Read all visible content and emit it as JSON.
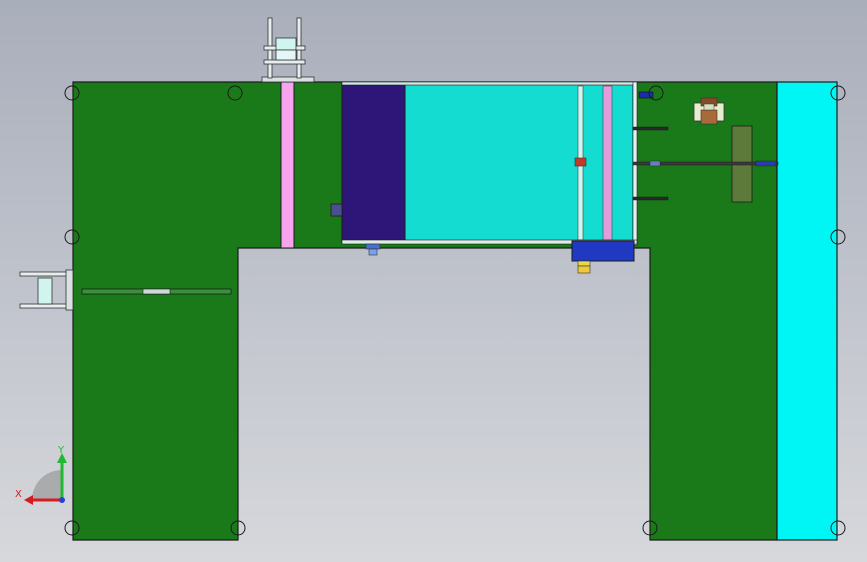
{
  "viewport": {
    "background_top": "#a9aebb",
    "background_bottom": "#d6d8dc"
  },
  "colors": {
    "frame_green": "#1a7a1a",
    "panel_cyan": "#00f5f5",
    "tank_teal": "#14dcd0",
    "motor_purple": "#2e1578",
    "base_blue": "#1f39c2",
    "slot_pink": "#f7a4ee",
    "bracket_olive": "#5e7a3a",
    "outline": "#1c1c1c"
  },
  "triad": {
    "x_label": "X",
    "y_label": "Y",
    "x_color": "#d21e1e",
    "y_color": "#22b833",
    "z_color": "#2b3fd6"
  },
  "icons": {
    "view-triad": "view-triad-icon",
    "corner-mark": "corner-mark-icon"
  }
}
